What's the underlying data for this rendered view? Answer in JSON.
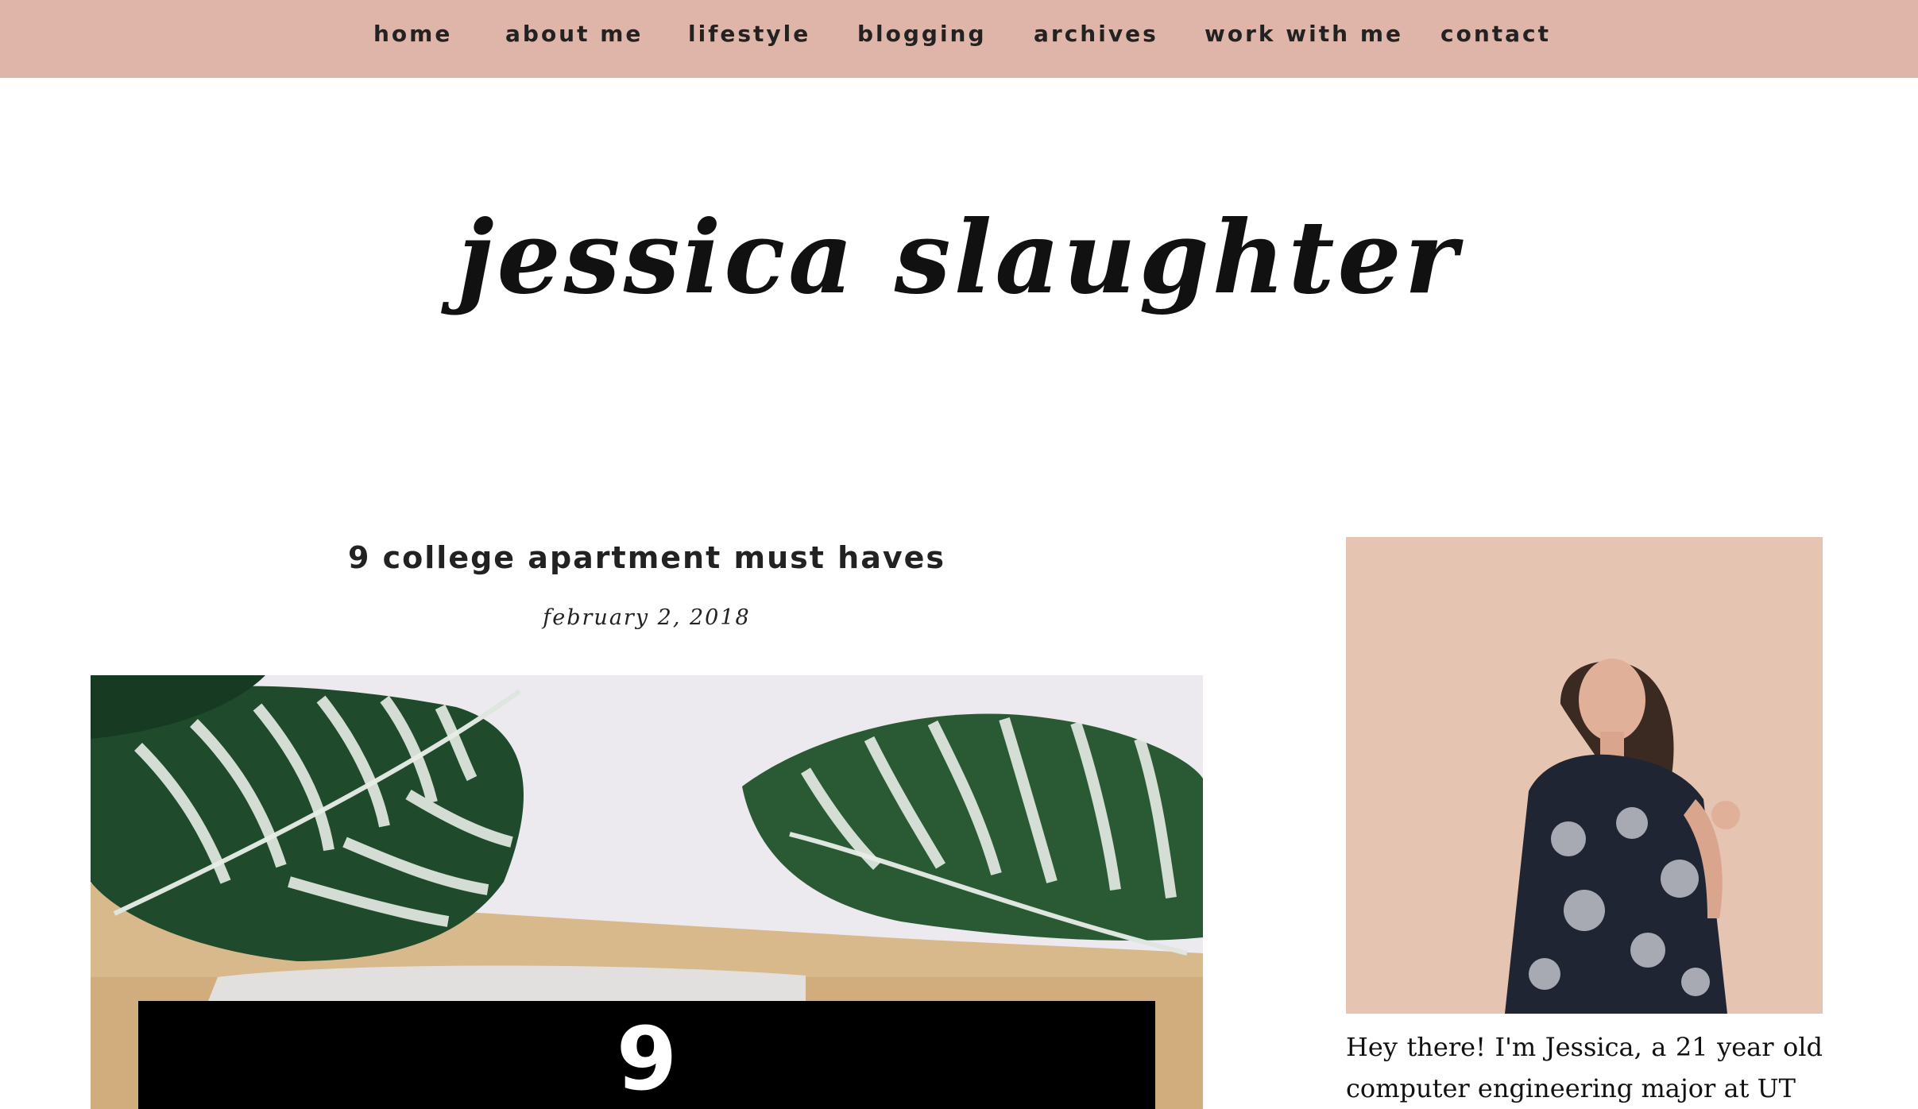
{
  "nav": {
    "items": [
      {
        "label": "home"
      },
      {
        "label": "about me"
      },
      {
        "label": "lifestyle"
      },
      {
        "label": "blogging"
      },
      {
        "label": "archives"
      },
      {
        "label": "work with me"
      },
      {
        "label": "contact"
      }
    ]
  },
  "site": {
    "title": "jessica slaughter"
  },
  "post": {
    "title": "9 college apartment must haves",
    "date": "february 2, 2018",
    "hero_number": "9"
  },
  "sidebar": {
    "bio": "Hey there! I'm Jessica, a 21 year old computer engineering major at UT"
  },
  "colors": {
    "nav_background": "#dfb5a9",
    "text": "#222222",
    "background": "#ffffff"
  }
}
